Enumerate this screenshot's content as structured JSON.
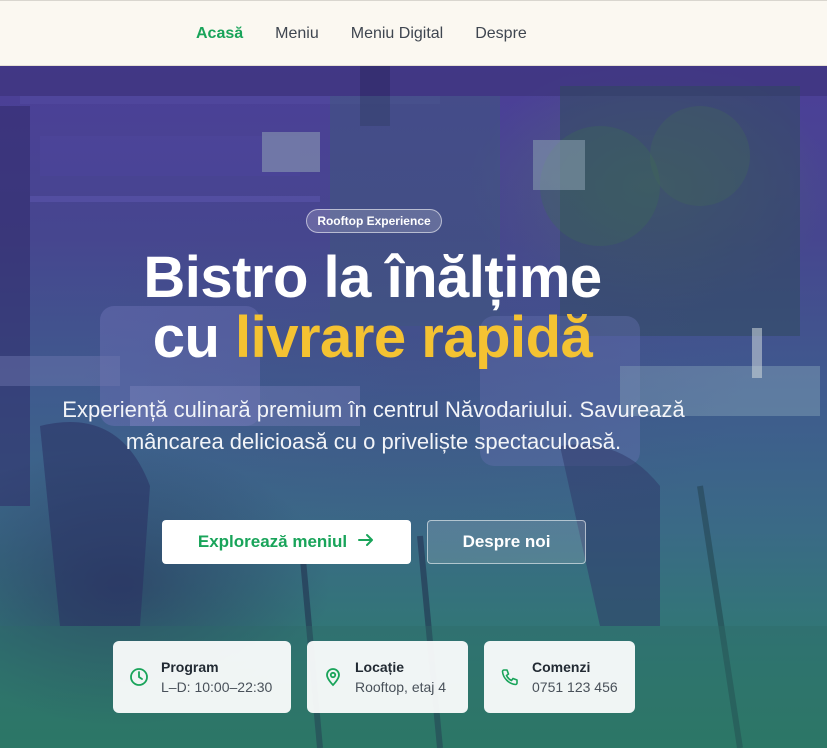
{
  "nav": {
    "items": [
      "Acasă",
      "Meniu",
      "Meniu Digital",
      "Despre"
    ]
  },
  "hero": {
    "badge": "Rooftop Experience",
    "title_line1": "Bistro la înălțime",
    "title_line2_plain": "cu",
    "title_line2_accent": "livrare rapidă",
    "subtitle": "Experiență culinară premium în centrul Năvodariului. Savurează mâncarea delicioasă cu o priveliște spectaculoasă.",
    "primary_button": "Explorează meniul",
    "secondary_button": "Despre noi"
  },
  "info_cards": [
    {
      "icon": "clock-icon",
      "label": "Program",
      "value": "L–D: 10:00–22:30"
    },
    {
      "icon": "location-pin-icon",
      "label": "Locație",
      "value": "Rooftop, etaj 4"
    },
    {
      "icon": "phone-icon",
      "label": "Comenzi",
      "value": "0751 123 456"
    }
  ],
  "colors": {
    "accent_green": "#19a45a",
    "accent_yellow": "#f4c232",
    "topbar_bg": "#fbf8f1"
  }
}
